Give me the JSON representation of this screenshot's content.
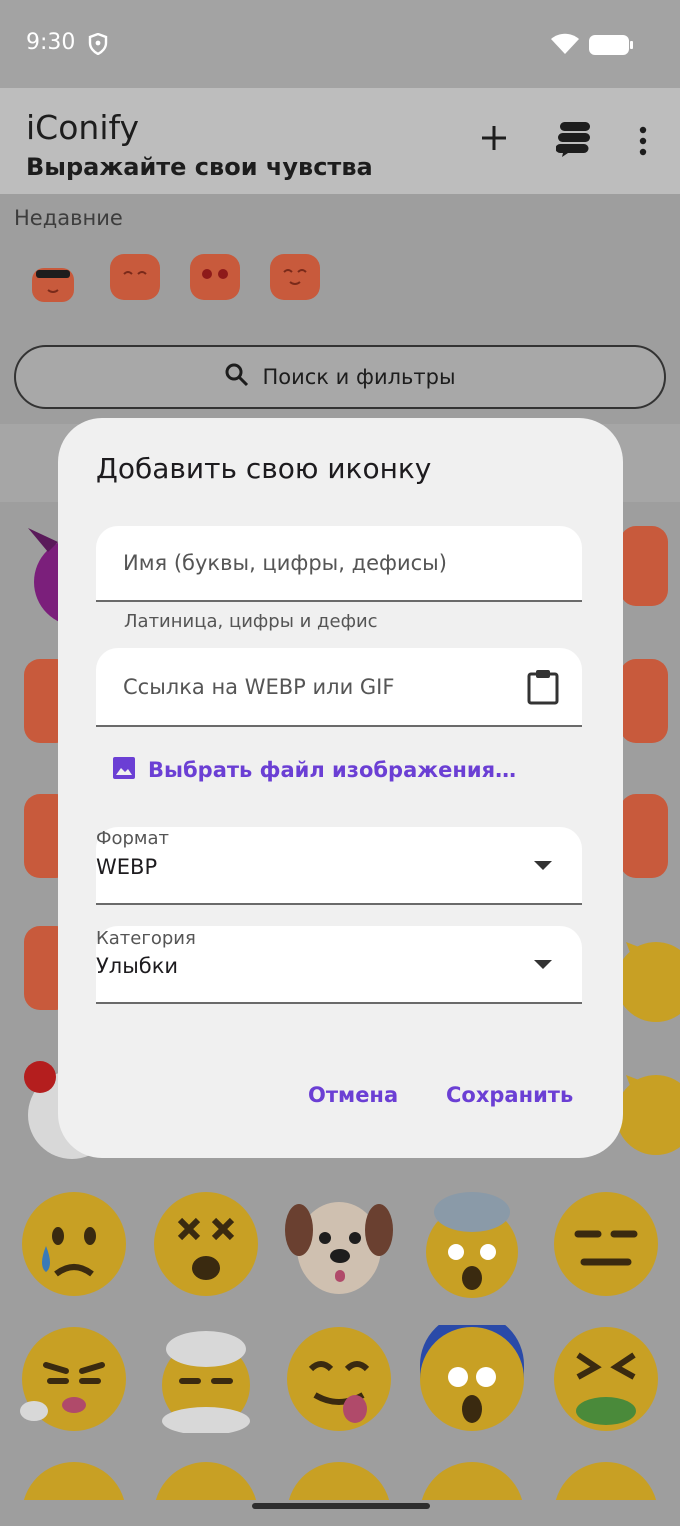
{
  "status_bar": {
    "time": "9:30"
  },
  "app_bar": {
    "title": "iConify",
    "subtitle": "Выражайте свои чувства",
    "icons": [
      "add-icon",
      "stack-icon",
      "more-vert-icon"
    ]
  },
  "recent": {
    "label": "Недавние",
    "count": 4
  },
  "search": {
    "label": "Поиск и фильтры"
  },
  "dialog": {
    "title": "Добавить свою иконку",
    "name_field": {
      "placeholder": "Имя (буквы, цифры, дефисы)",
      "helper": "Латиница, цифры и дефис"
    },
    "url_field": {
      "placeholder": "Ссылка на WEBP или GIF"
    },
    "pick_file_label": "Выбрать файл изображения…",
    "format": {
      "label": "Формат",
      "value": "WEBP"
    },
    "category": {
      "label": "Категория",
      "value": "Улыбки"
    },
    "cancel_label": "Отмена",
    "save_label": "Сохранить"
  },
  "colors": {
    "accent": "#6b3fd4",
    "scrim": "#9e9e9e",
    "emoji_yellow": "#c8a024",
    "sticker_orange": "#c85a3c"
  }
}
